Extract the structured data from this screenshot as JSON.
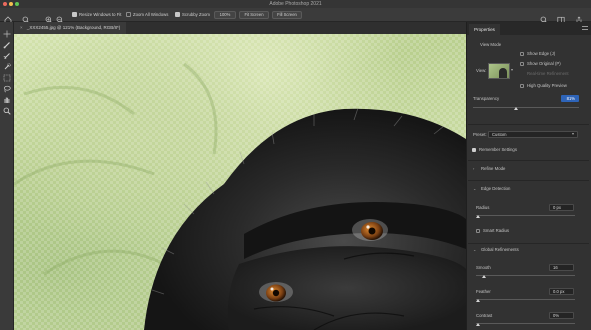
{
  "window": {
    "title": "Adobe Photoshop 2021",
    "traffic_colors": [
      "#ec6a5e",
      "#f4bf4f",
      "#61c554"
    ]
  },
  "options_bar": {
    "icons": [
      "home-icon",
      "zoom-tool-icon",
      "zoom-in-icon",
      "zoom-out-icon"
    ],
    "resize_windows_label": "Resize Windows to Fit",
    "zoom_all_windows_label": "Zoom All Windows",
    "scrubby_zoom_label": "Scrubby Zoom",
    "btn_100": "100%",
    "btn_fit": "Fit Screen",
    "btn_fill": "Fill Screen",
    "right_icons": [
      "search-icon",
      "workspace-icon",
      "share-icon"
    ]
  },
  "document": {
    "tab_label": "_XXX2455.jpg @ 121% (Background, RGB/8*)",
    "close_glyph": "×"
  },
  "tools": [
    "move-tool-icon",
    "brush-tool-icon",
    "refine-edge-brush-icon",
    "quick-selection-icon",
    "object-select-icon",
    "lasso-icon",
    "hand-icon",
    "zoom-icon"
  ],
  "properties": {
    "tab_label": "Properties",
    "view_mode_label": "View Mode",
    "view_label": "View:",
    "show_edge": "Show Edge (J)",
    "show_original": "Show Original (P)",
    "real_time_refinement": "Real-time Refinement",
    "high_quality_preview": "High Quality Preview",
    "transparency_label": "Transparency",
    "transparency_value": "81%",
    "transparency_level": 0.81,
    "preset_label": "Preset:",
    "preset_value": "Custom",
    "remember_settings": "Remember Settings",
    "refine_mode": "Refine Mode",
    "edge_detection": "Edge Detection",
    "radius_label": "Radius",
    "radius_value": "0 px",
    "smart_radius": "Smart Radius",
    "global_refinements": "Global Refinements",
    "smooth_label": "Smooth",
    "smooth_value": "16",
    "smooth_level": 0.16,
    "feather_label": "Feather",
    "feather_value": "0.0 px",
    "contrast_label": "Contrast",
    "contrast_value": "0%"
  }
}
